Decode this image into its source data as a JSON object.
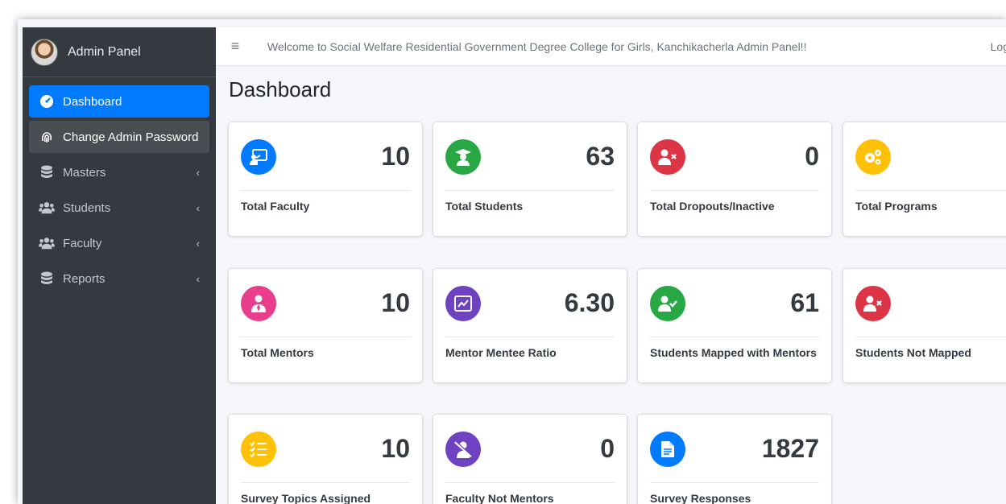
{
  "sidebar": {
    "brand": "Admin Panel",
    "items": [
      {
        "label": "Dashboard",
        "icon": "tachometer-icon"
      },
      {
        "label": "Change Admin Password",
        "icon": "fingerprint-icon"
      },
      {
        "label": "Masters",
        "icon": "database-icon"
      },
      {
        "label": "Students",
        "icon": "users-icon"
      },
      {
        "label": "Faculty",
        "icon": "users-icon"
      },
      {
        "label": "Reports",
        "icon": "database-icon"
      }
    ],
    "chevron": "‹"
  },
  "header": {
    "menu_icon": "≡",
    "welcome": "Welcome to Social Welfare Residential Government Degree College for Girls, Kanchikacherla Admin Panel!!",
    "logout": "Log"
  },
  "page": {
    "title": "Dashboard"
  },
  "cards": [
    {
      "label": "Total Faculty",
      "value": "10",
      "color": "#007bff",
      "icon": "chalkboard-teacher-icon"
    },
    {
      "label": "Total Students",
      "value": "63",
      "color": "#28a745",
      "icon": "graduate-icon"
    },
    {
      "label": "Total Dropouts/Inactive",
      "value": "0",
      "color": "#dc3545",
      "icon": "user-times-icon"
    },
    {
      "label": "Total Programs",
      "value": "",
      "color": "#ffc107",
      "icon": "cogs-icon"
    },
    {
      "label": "Total Mentors",
      "value": "10",
      "color": "#e83e8c",
      "icon": "user-tie-icon"
    },
    {
      "label": "Mentor Mentee Ratio",
      "value": "6.30",
      "color": "#6f42c1",
      "icon": "chart-line-icon"
    },
    {
      "label": "Students Mapped with Mentors",
      "value": "61",
      "color": "#28a745",
      "icon": "user-check-icon"
    },
    {
      "label": "Students Not Mapped",
      "value": "",
      "color": "#dc3545",
      "icon": "user-times-icon"
    },
    {
      "label": "Survey Topics Assigned",
      "value": "10",
      "color": "#ffc107",
      "icon": "tasks-icon"
    },
    {
      "label": "Faculty Not Mentors",
      "value": "0",
      "color": "#6f42c1",
      "icon": "user-slash-icon"
    },
    {
      "label": "Survey Responses",
      "value": "1827",
      "color": "#007bff",
      "icon": "file-icon"
    }
  ]
}
